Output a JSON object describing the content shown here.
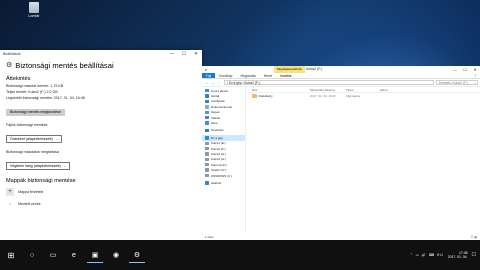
{
  "desktop": {
    "icon_label": "Lomtár"
  },
  "settings": {
    "app_title": "Beállítások",
    "controls": {
      "minimize": "—",
      "maximize": "☐",
      "close": "✕"
    },
    "heading": "Biztonsági mentés beállításai",
    "overview_title": "Áttekintés",
    "backup_size": "Biztonsági másolat mérete: 1,75 KB",
    "total_space": "Teljes terület: Kulcs2 (F:) 2,0 GB",
    "last_backup": "Legutóbbi biztonsági mentés: 2017. 01. 04. 16:48",
    "backup_now": "Biztonsági mentés megkezdése",
    "frequency_label": "Fájlok biztonsági mentése",
    "frequency_value": "Óránként (alapértelmezett)",
    "retention_label": "Biztonsági másolatok megtartása",
    "retention_value": "Végtelen ideig (alapértelmezett)",
    "folders_title": "Mappák biztonsági mentése",
    "add_folder": "Mappa felvétele",
    "music_folder": "Mentett zenék"
  },
  "explorer": {
    "quick_access": "▾",
    "context_tab": "Meghajtóeszközök",
    "title": "Kulcs2 (F:)",
    "controls": {
      "minimize": "—",
      "maximize": "☐",
      "close": "✕"
    },
    "tabs": [
      "Fájl",
      "Kezdőlap",
      "Megosztás",
      "Nézet",
      "Kezelés"
    ],
    "help": "?",
    "address": "› Ez a gép › Kulcs2 (F:)",
    "search_placeholder": "Keresés: Kulcs2 (F:)",
    "nav": [
      {
        "label": "Gyors elérés",
        "color": "#3b8ee0"
      },
      {
        "label": "Asztal",
        "color": "#2f80d8"
      },
      {
        "label": "Letöltések",
        "color": "#2f80d8"
      },
      {
        "label": "Dokumentumok",
        "color": "#9aa7b8"
      },
      {
        "label": "Képek",
        "color": "#4a9bd8"
      },
      {
        "label": "Videók",
        "color": "#6a6fd0"
      },
      {
        "label": "Zene",
        "color": "#3a8fd8"
      },
      {
        "label": "OneDrive",
        "color": "#2a78d0"
      },
      {
        "label": "Ez a gép",
        "color": "#3a85d0",
        "selected": true
      },
      {
        "label": "Kulcs1 (E:)",
        "color": "#8a97a8"
      },
      {
        "label": "Kulcs2 (F:)",
        "color": "#8a97a8"
      },
      {
        "label": "Kulcs3 (G:)",
        "color": "#8a97a8"
      },
      {
        "label": "Kulcs4 (H:)",
        "color": "#8a97a8"
      },
      {
        "label": "Kamera (K:)",
        "color": "#8a97a8"
      },
      {
        "label": "Telefon (P:)",
        "color": "#8a97a8"
      },
      {
        "label": "WINDOWS (C:)",
        "color": "#8a97a8"
      },
      {
        "label": "Hálózat",
        "color": "#3a85d0"
      }
    ],
    "columns": [
      "Név",
      "Módosítás dátuma",
      "Típus",
      "Méret"
    ],
    "rows": [
      {
        "name": "FileHistory",
        "date": "2017. 01. 04. 16:47",
        "type": "Fájlmappa",
        "size": ""
      }
    ],
    "status": "1 elem",
    "views": "☰ ▦"
  },
  "taskbar": {
    "start": "⊞",
    "items": [
      "○",
      "▭",
      "e",
      "▣",
      "◉",
      "⚙"
    ],
    "system_icons": "⌃ ▭ 🔊 ⌨ HU",
    "time": "17:48",
    "date": "2017. 01. 04.",
    "notification": "☐"
  }
}
